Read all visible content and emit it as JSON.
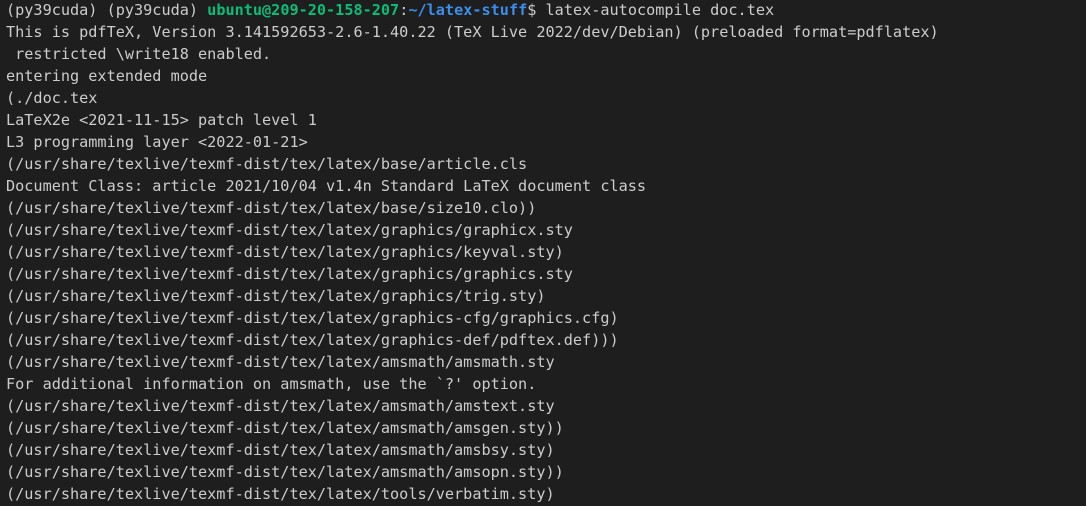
{
  "terminal": {
    "prompt": {
      "env": "(py39cuda) (py39cuda) ",
      "user_host": "ubuntu@209-20-158-207",
      "colon": ":",
      "path": "~/latex-stuff",
      "dollar": "$ ",
      "command": "latex-autocompile doc.tex"
    },
    "output_lines": [
      "This is pdfTeX, Version 3.141592653-2.6-1.40.22 (TeX Live 2022/dev/Debian) (preloaded format=pdflatex)",
      " restricted \\write18 enabled.",
      "entering extended mode",
      "(./doc.tex",
      "LaTeX2e <2021-11-15> patch level 1",
      "L3 programming layer <2022-01-21>",
      "(/usr/share/texlive/texmf-dist/tex/latex/base/article.cls",
      "Document Class: article 2021/10/04 v1.4n Standard LaTeX document class",
      "(/usr/share/texlive/texmf-dist/tex/latex/base/size10.clo))",
      "(/usr/share/texlive/texmf-dist/tex/latex/graphics/graphicx.sty",
      "(/usr/share/texlive/texmf-dist/tex/latex/graphics/keyval.sty)",
      "(/usr/share/texlive/texmf-dist/tex/latex/graphics/graphics.sty",
      "(/usr/share/texlive/texmf-dist/tex/latex/graphics/trig.sty)",
      "(/usr/share/texlive/texmf-dist/tex/latex/graphics-cfg/graphics.cfg)",
      "(/usr/share/texlive/texmf-dist/tex/latex/graphics-def/pdftex.def)))",
      "(/usr/share/texlive/texmf-dist/tex/latex/amsmath/amsmath.sty",
      "For additional information on amsmath, use the `?' option.",
      "(/usr/share/texlive/texmf-dist/tex/latex/amsmath/amstext.sty",
      "(/usr/share/texlive/texmf-dist/tex/latex/amsmath/amsgen.sty))",
      "(/usr/share/texlive/texmf-dist/tex/latex/amsmath/amsbsy.sty)",
      "(/usr/share/texlive/texmf-dist/tex/latex/amsmath/amsopn.sty))",
      "(/usr/share/texlive/texmf-dist/tex/latex/tools/verbatim.sty)"
    ]
  },
  "colors": {
    "background": "#1e1e1e",
    "foreground": "#cccccc",
    "prompt_user": "#0dbc79",
    "prompt_path": "#3b8eea"
  }
}
